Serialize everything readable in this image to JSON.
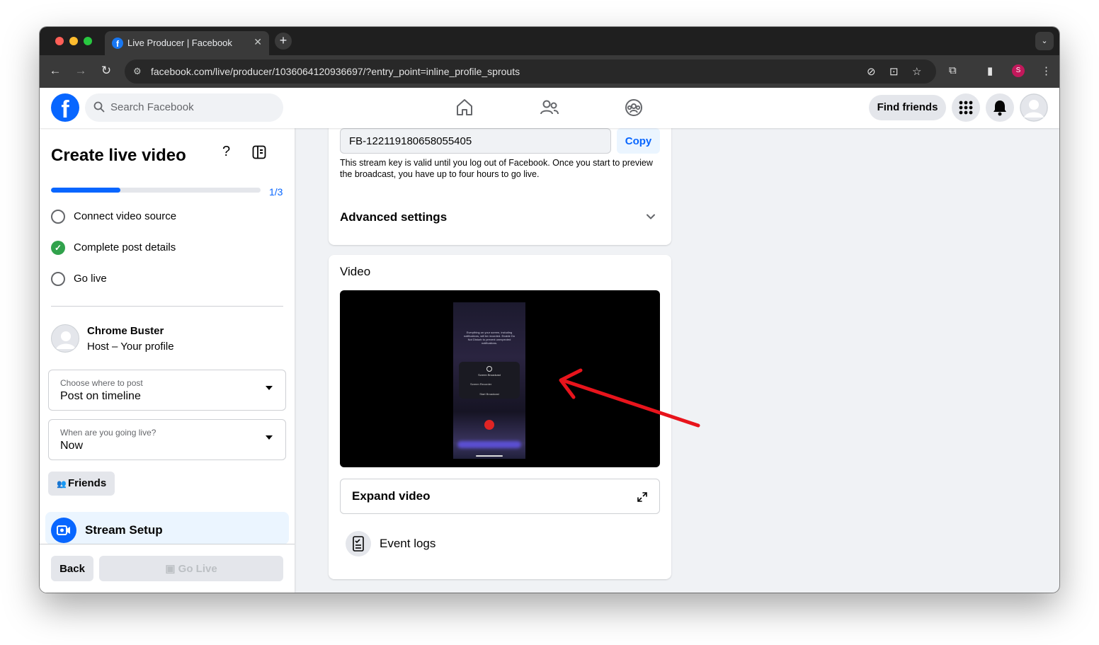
{
  "browser": {
    "tab_title": "Live Producer | Facebook",
    "tab_favicon": "facebook-f-icon",
    "url": "facebook.com/live/producer/1036064120936697/?entry_point=inline_profile_sprouts",
    "profile_initial": "S",
    "colors": {
      "frame": "#1f1f1f",
      "toolbar": "#3a3a3a",
      "profile": "#c2185b"
    }
  },
  "header": {
    "logo_letter": "f",
    "search_placeholder": "Search Facebook",
    "nav_icons": [
      "home-icon",
      "friends-icon",
      "groups-icon"
    ],
    "find_friends_label": "Find friends",
    "right_icons": [
      "menu-grid-icon",
      "notifications-bell-icon",
      "profile-avatar-icon"
    ]
  },
  "sidebar": {
    "title": "Create live video",
    "progress": {
      "label": "1/3",
      "fraction": 0.33
    },
    "steps": [
      {
        "label": "Connect video source",
        "state": "incomplete"
      },
      {
        "label": "Complete post details",
        "state": "complete"
      },
      {
        "label": "Go live",
        "state": "incomplete"
      }
    ],
    "host": {
      "name": "Chrome Buster",
      "role": "Host – Your profile"
    },
    "post_location": {
      "label": "Choose where to post",
      "value": "Post on timeline"
    },
    "go_live_time": {
      "label": "When are you going live?",
      "value": "Now"
    },
    "audience_label": "Friends",
    "stream_setup_label": "Stream Setup",
    "back_label": "Back",
    "go_live_label": "Go Live"
  },
  "main": {
    "stream_key": "FB-122119180658055405",
    "copy_label": "Copy",
    "stream_key_note": "This stream key is valid until you log out of Facebook. Once you start to preview the broadcast, you have up to four hours to go live.",
    "advanced_settings_label": "Advanced settings",
    "video_title": "Video",
    "video_preview_text": "Everything on your screen, including notifications, will be recorded. Enable Do Not Disturb to prevent unexpected notifications.",
    "phone_card_title": "Screen Broadcast",
    "phone_card_option": "Screen Recorder",
    "phone_card_action": "Start Broadcast",
    "expand_video_label": "Expand video",
    "event_logs_label": "Event logs"
  },
  "colors": {
    "accent": "#0866ff",
    "success": "#31a24c",
    "annotation_arrow": "#e8141c"
  }
}
